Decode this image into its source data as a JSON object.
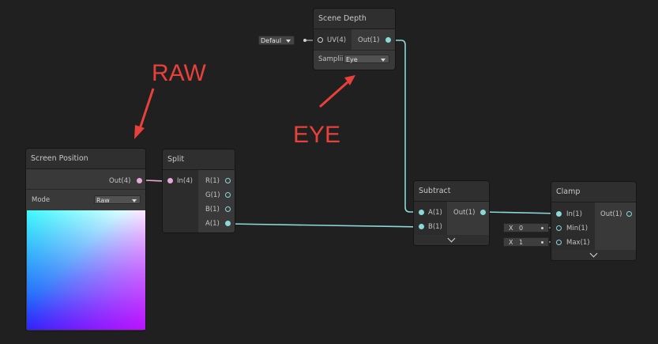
{
  "colors": {
    "canvas": "#202020",
    "node_body": "#393939",
    "node_header": "#2f2f2f",
    "wire_float": "#8ad8d8",
    "wire_vector4": "#e7a9d8",
    "annotation": "#e8403a"
  },
  "annotations": {
    "raw": "RAW",
    "eye": "EYE"
  },
  "scene_depth": {
    "title": "Scene Depth",
    "uv_default": "Defaul",
    "uv_label": "UV(4)",
    "out_label": "Out(1)",
    "sampling_label": "Samplii",
    "sampling_value": "Eye"
  },
  "screen_position": {
    "title": "Screen Position",
    "out_label": "Out(4)",
    "mode_label": "Mode",
    "mode_value": "Raw"
  },
  "split": {
    "title": "Split",
    "in_label": "In(4)",
    "outputs": [
      "R(1)",
      "G(1)",
      "B(1)",
      "A(1)"
    ]
  },
  "subtract": {
    "title": "Subtract",
    "a_label": "A(1)",
    "b_label": "B(1)",
    "out_label": "Out(1)"
  },
  "clamp": {
    "title": "Clamp",
    "in_label": "In(1)",
    "min_label": "Min(1)",
    "max_label": "Max(1)",
    "out_label": "Out(1)",
    "min_axis": "X",
    "min_value": "0",
    "max_axis": "X",
    "max_value": "1"
  },
  "icons": {
    "collapse": "chevron-down-icon",
    "dropdown": "caret-down-icon",
    "arrow": "red-arrow-icon"
  }
}
